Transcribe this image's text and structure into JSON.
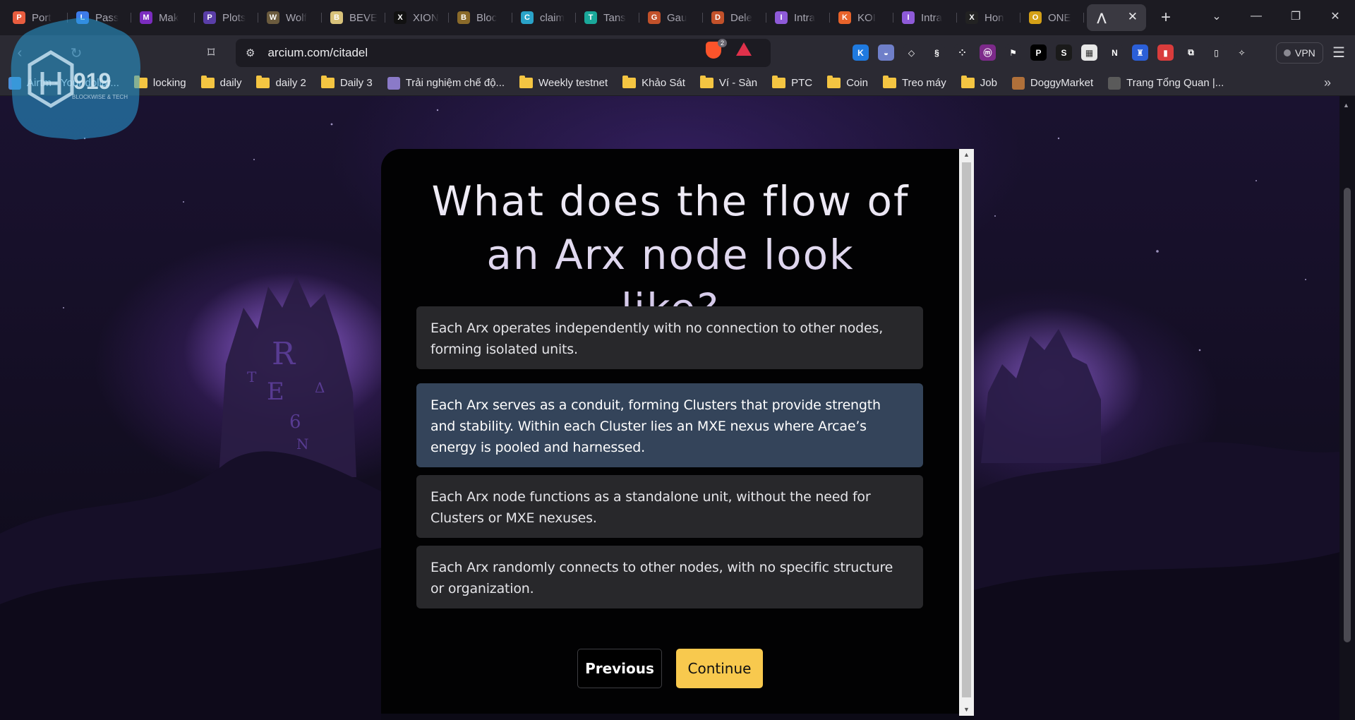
{
  "browser": {
    "tabs": [
      {
        "title": "Port",
        "color": "#e85d3f",
        "glyph": "P"
      },
      {
        "title": "Pass",
        "color": "#3d7be8",
        "glyph": "L"
      },
      {
        "title": "Mak",
        "color": "#7b2cbf",
        "glyph": "M"
      },
      {
        "title": "Plots",
        "color": "#5a3ea8",
        "glyph": "P"
      },
      {
        "title": "Wolf",
        "color": "#6b5b3e",
        "glyph": "W"
      },
      {
        "title": "BEVE",
        "color": "#d8c27a",
        "glyph": "B"
      },
      {
        "title": "XION",
        "color": "#111111",
        "glyph": "X"
      },
      {
        "title": "Bloc",
        "color": "#8a6a2a",
        "glyph": "B"
      },
      {
        "title": "claim",
        "color": "#2aa3c9",
        "glyph": "C"
      },
      {
        "title": "Tans",
        "color": "#1aa89a",
        "glyph": "T"
      },
      {
        "title": "Gau",
        "color": "#c2512a",
        "glyph": "G"
      },
      {
        "title": "Dele",
        "color": "#c2512a",
        "glyph": "D"
      },
      {
        "title": "Intra",
        "color": "#8e5ad8",
        "glyph": "I"
      },
      {
        "title": "KOI",
        "color": "#e8632a",
        "glyph": "K"
      },
      {
        "title": "Intra",
        "color": "#8e5ad8",
        "glyph": "I"
      },
      {
        "title": "Hon",
        "color": "#222222",
        "glyph": "X"
      },
      {
        "title": "ONE",
        "color": "#d4a017",
        "glyph": "O"
      }
    ],
    "active_tab_close": "✕",
    "new_tab": "+",
    "url": "arcium.com/citadel",
    "shield_badge": "2",
    "vpn_label": "VPN",
    "extensions": [
      {
        "color": "#1f7ae0",
        "glyph": "K"
      },
      {
        "color": "#6f7fc9",
        "glyph": "◒"
      },
      {
        "color": "#2b2a33",
        "glyph": "◇"
      },
      {
        "color": "#2b2a33",
        "glyph": "§"
      },
      {
        "color": "#2b2a33",
        "glyph": "⁘"
      },
      {
        "color": "#7d2a8a",
        "glyph": "ⓜ"
      },
      {
        "color": "#2b2a33",
        "glyph": "⚑"
      },
      {
        "color": "#000000",
        "glyph": "P"
      },
      {
        "color": "#1a1a1a",
        "glyph": "S"
      },
      {
        "color": "#e8e8e8",
        "glyph": "▦"
      },
      {
        "color": "#2b2a33",
        "glyph": "N"
      },
      {
        "color": "#2b5fd8",
        "glyph": "♜"
      },
      {
        "color": "#d93c3c",
        "glyph": "▮"
      },
      {
        "color": "#2b2a33",
        "glyph": "⧉"
      },
      {
        "color": "#2b2a33",
        "glyph": "▯"
      },
      {
        "color": "#2b2a33",
        "glyph": "✧"
      }
    ],
    "bookmarks": [
      {
        "label": "Airtm - Your dollar...",
        "type": "site",
        "color": "#4a90d9"
      },
      {
        "label": "locking",
        "type": "folder"
      },
      {
        "label": "daily",
        "type": "folder"
      },
      {
        "label": "daily 2",
        "type": "folder"
      },
      {
        "label": "Daily 3",
        "type": "folder"
      },
      {
        "label": "Trải nghiệm chế độ...",
        "type": "site",
        "color": "#8a7ac8"
      },
      {
        "label": "Weekly testnet",
        "type": "folder"
      },
      {
        "label": "Khảo Sát",
        "type": "folder"
      },
      {
        "label": "Ví - Sàn",
        "type": "folder"
      },
      {
        "label": "PTC",
        "type": "folder"
      },
      {
        "label": "Coin",
        "type": "folder"
      },
      {
        "label": "Treo máy",
        "type": "folder"
      },
      {
        "label": "Job",
        "type": "folder"
      },
      {
        "label": "DoggyMarket",
        "type": "site",
        "color": "#b0703a"
      },
      {
        "label": "Trang Tổng Quan |...",
        "type": "site",
        "color": "#5a5a5a"
      }
    ],
    "bookmark_more": "»"
  },
  "watermark": {
    "number": "919",
    "tagline": "BLOCKWISE & TECH"
  },
  "quiz": {
    "question": "What does the flow of an Arx node look like?",
    "options": [
      {
        "text": "Each Arx operates independently with no connection to other nodes, forming isolated units.",
        "selected": false
      },
      {
        "text": "Each Arx serves as a conduit, forming Clusters that provide strength and stability. Within each Cluster lies an MXE nexus where Arcae’s energy is pooled and harnessed.",
        "selected": true
      },
      {
        "text": "Each Arx node functions as a standalone unit, without the need for Clusters or MXE nexuses.",
        "selected": false
      },
      {
        "text": "Each Arx randomly connects to other nodes, with no specific structure or organization.",
        "selected": false
      }
    ],
    "previous_label": "Previous",
    "continue_label": "Continue"
  },
  "colors": {
    "accent_button": "#f8c94e",
    "selected_option": "#34445a",
    "option_bg": "#28282b",
    "card_bg": "#020203"
  }
}
